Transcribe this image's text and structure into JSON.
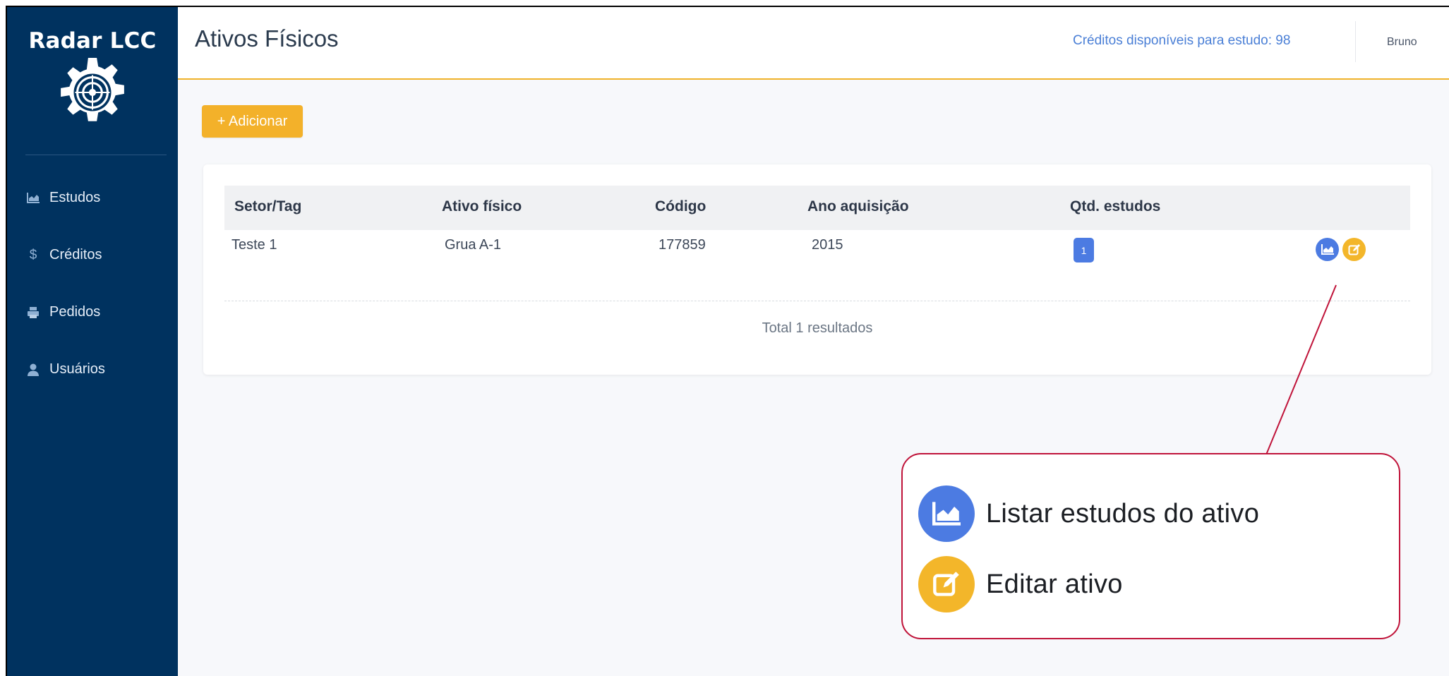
{
  "brand": {
    "name": "Radar LCC"
  },
  "sidebar": {
    "items": [
      {
        "label": "Estudos",
        "icon": "area-chart-icon"
      },
      {
        "label": "Créditos",
        "icon": "dollar-icon"
      },
      {
        "label": "Pedidos",
        "icon": "printer-icon"
      },
      {
        "label": "Usuários",
        "icon": "user-icon"
      }
    ]
  },
  "header": {
    "title": "Ativos Físicos",
    "credits": "Créditos disponíveis para estudo: 98",
    "user": "Bruno"
  },
  "toolbar": {
    "add_label": "+ Adicionar"
  },
  "table": {
    "columns": [
      "Setor/Tag",
      "Ativo físico",
      "Código",
      "Ano aquisição",
      "Qtd. estudos"
    ],
    "rows": [
      {
        "setor": "Teste 1",
        "ativo": "Grua A-1",
        "codigo": "177859",
        "ano": "2015",
        "qtd": "1"
      }
    ],
    "total": "Total 1 resultados"
  },
  "legend": {
    "list_studies": "Listar estudos do ativo",
    "edit_asset": "Editar ativo"
  },
  "colors": {
    "sidebar": "#00325f",
    "accent": "#f3b12a",
    "primary": "#4c7be2",
    "callout_border": "#c0143a"
  }
}
